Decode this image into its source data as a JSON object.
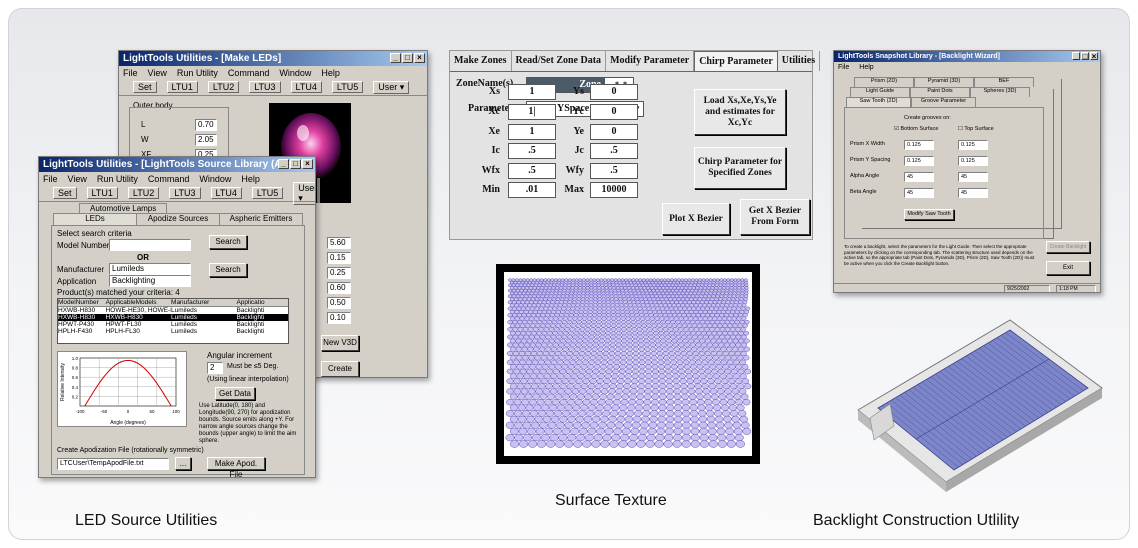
{
  "captions": {
    "led": "LED Source Utilities",
    "surface": "Surface Texture",
    "backlight": "Backlight Construction Utlility"
  },
  "win_back": {
    "title": "LightTools Utilities - [Make LEDs]",
    "menu": [
      "File",
      "View",
      "Run Utility",
      "Command",
      "Window",
      "Help"
    ],
    "toolbar": [
      "Set",
      "LTU1",
      "LTU2",
      "LTU3",
      "LTU4",
      "LTU5",
      "User ▾"
    ],
    "group": "Outer body",
    "fields": [
      {
        "label": "L",
        "value": "0.70"
      },
      {
        "label": "W",
        "value": "2.05"
      },
      {
        "label": "XF",
        "value": "0.25"
      }
    ],
    "right_values": [
      "5.60",
      "0.15",
      "0.25",
      "0.60",
      "0.50",
      "0.10"
    ],
    "buttons": [
      "New V3D",
      "Create LED"
    ]
  },
  "win_front": {
    "title": "LightTools Utilities - [LightTools Source Library (Angular",
    "menu": [
      "File",
      "View",
      "Run Utility",
      "Command",
      "Window",
      "Help"
    ],
    "toolbar": [
      "Set",
      "LTU1",
      "LTU2",
      "LTU3",
      "LTU4",
      "LTU5",
      "User ▾"
    ],
    "tabs_top": [
      "Automotive Lamps"
    ],
    "tabs": [
      "LEDs",
      "Apodize Sources",
      "Aspheric Emitters"
    ],
    "select_label": "Select search criteria",
    "model_label": "Model Number",
    "or": "OR",
    "search": "Search",
    "manufacturer_label": "Manufacturer",
    "manufacturer": "Lumileds",
    "application_label": "Application",
    "application": "Backlighting",
    "matched": "Product(s) matched your criteria:",
    "matched_count": "4",
    "table_headers": [
      "ModelNumber",
      "ApplicableModels",
      "Manufacturer",
      "Applicatio"
    ],
    "rows": [
      [
        "HXWB-H830",
        "HOWE-HE30, HOWE-H",
        "Lumileds",
        "Backlighti"
      ],
      [
        "HXWB-H830",
        "HXWB-H830",
        "Lumileds",
        "Backlighti"
      ],
      [
        "HPWT-P430",
        "HPWT-FL30",
        "Lumileds",
        "Backlighti"
      ],
      [
        "HPLH-F430",
        "HPLH-FL30",
        "Lumileds",
        "Backlighti"
      ]
    ],
    "angular_label": "Angular increment",
    "angular_value": "2",
    "angular_unit": "Must be ≤5 Deg.",
    "interp": "(Using linear interpolation)",
    "get_data": "Get Data",
    "note": "Use Latitude(0, 180) and Longitude(90, 270) for apodization bounds. Source emits along +Y. For narrow angle sources change the bounds (upper angle) to limit the aim sphere.",
    "chart_xlabel": "Angle (degrees)",
    "chart_ylabel": "Relative Intensity",
    "chart_xticks": [
      "-100",
      "-50",
      "0",
      "50",
      "100"
    ],
    "chart_yticks": [
      "0.2",
      "0.4",
      "0.6",
      "0.8",
      "1.0"
    ],
    "file_label": "Create Apodization File (rotationally symmetric)",
    "file_value": "LTCUser\\TempApodFile.txt",
    "browse": "...",
    "make_file": "Make Apod. File"
  },
  "chirp": {
    "tabs": [
      "Make Zones",
      "Read/Set Zone Data",
      "Modify Parameter",
      "Chirp Parameter",
      "Utilities"
    ],
    "zone_label": "ZoneName(s)",
    "zone_value": "Zone",
    "zone_suffix": "_*_*",
    "param_label": "Parameter",
    "param_value": "YSpace",
    "left": [
      {
        "label": "Xs",
        "value": "1"
      },
      {
        "label": "Xc",
        "value": "1|"
      },
      {
        "label": "Xe",
        "value": "1"
      },
      {
        "label": "Ic",
        "value": ".5"
      },
      {
        "label": "Wfx",
        "value": ".5"
      },
      {
        "label": "Min",
        "value": ".01"
      }
    ],
    "right": [
      {
        "label": "Ys",
        "value": "0"
      },
      {
        "label": "Yc",
        "value": "0"
      },
      {
        "label": "Ye",
        "value": "0"
      },
      {
        "label": "Jc",
        "value": ".5"
      },
      {
        "label": "Wfy",
        "value": ".5"
      },
      {
        "label": "Max",
        "value": "10000"
      }
    ],
    "btn_load": "Load Xs,Xe,Ys,Ye and estimates for Xc,Yc",
    "btn_chirp": "Chirp Parameter for Specified Zones",
    "btn_plot": "Plot X Bezier",
    "btn_get": "Get X Bezier From Form"
  },
  "backlight_win": {
    "title": "LightTools Snapshot Library - [Backlight Wizard]",
    "menu": [
      "File",
      "Help"
    ],
    "tabs_row1": [
      "Prism (2D)",
      "Pyramid (3D)",
      "BEF"
    ],
    "tabs_row2": [
      "Light Guide",
      "Paint Dots",
      "Spheres (3D)"
    ],
    "tabs_row3": [
      "Saw Tooth (2D)",
      "Groove Parameter"
    ],
    "create_on": "Create grooves on:",
    "bottom": "Bottom Surface",
    "top": "Top Surface",
    "fields": [
      {
        "label": "Prism X Width",
        "v1": "0.125",
        "v2": "0.125"
      },
      {
        "label": "Prism Y Spacing",
        "v1": "0.125",
        "v2": "0.125"
      },
      {
        "label": "Alpha Angle",
        "v1": "45",
        "v2": "45"
      },
      {
        "label": "Beta Angle",
        "v1": "45",
        "v2": "45"
      }
    ],
    "modify": "Modify Saw Tooth",
    "desc": "To create a backlight, select the parameters for the Light Guide. Then select the appropriate parameters by clicking on the corresponding tab. The scattering structure used depends on the active tab, so the appropriate tab (Paint Dots, Pyramids (3D), Prism (2D), Saw Tooth (2D)) must be active when you click the Create Backlight button.",
    "create": "Create Backlight",
    "exit": "Exit",
    "status_date": "9/25/2002",
    "status_time": "1:18 PM"
  }
}
